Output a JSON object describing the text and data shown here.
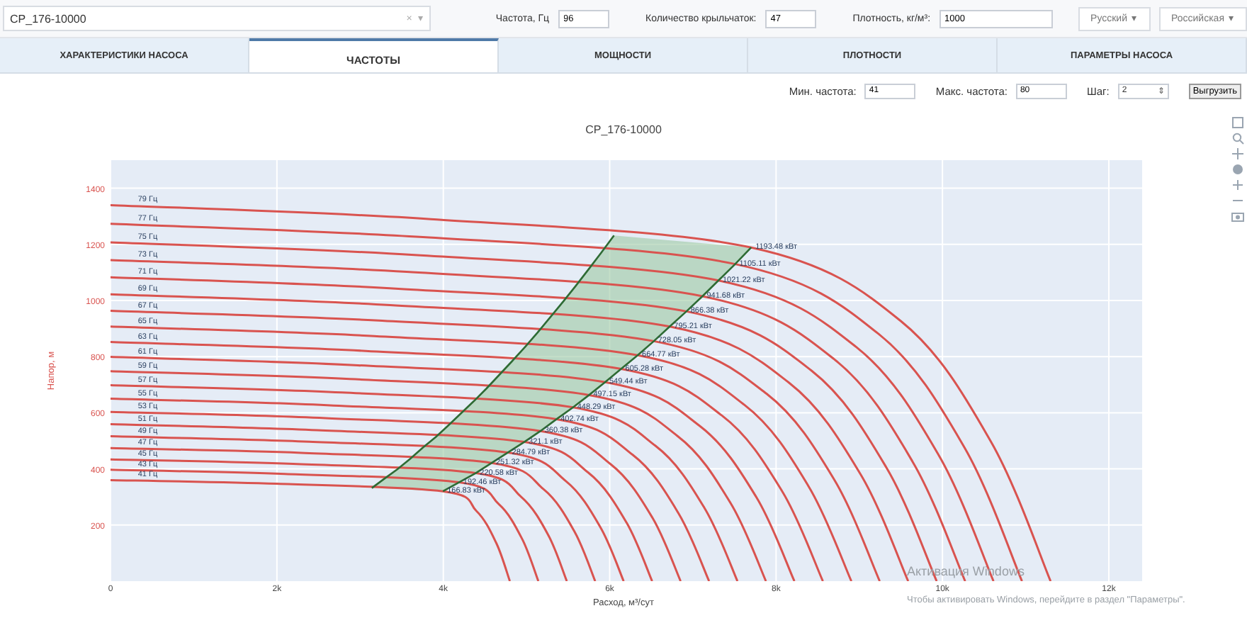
{
  "top_bar": {
    "pump_select": {
      "value": "CP_176-10000",
      "clear": "×",
      "caret": "▾"
    },
    "fields": [
      {
        "label": "Частота, Гц",
        "value": "96",
        "kind": "short"
      },
      {
        "label": "Количество крыльчаток:",
        "value": "47",
        "kind": "short"
      },
      {
        "label": "Плотность, кг/м³:",
        "value": "1000",
        "kind": "long"
      }
    ],
    "dropdowns": [
      {
        "value": "Русский",
        "caret": "▾"
      },
      {
        "value": "Российская",
        "caret": "▾"
      }
    ]
  },
  "tabs": [
    {
      "label": "ХАРАКТЕРИСТИКИ НАСОСА",
      "selected": false
    },
    {
      "label": "ЧАСТОТЫ",
      "selected": true
    },
    {
      "label": "МОЩНОСТИ",
      "selected": false
    },
    {
      "label": "ПЛОТНОСТИ",
      "selected": false
    },
    {
      "label": "ПАРАМЕТРЫ НАСОСА",
      "selected": false
    }
  ],
  "controls": {
    "fields": [
      {
        "label": "Мин. частота:",
        "value": "41"
      },
      {
        "label": "Макс. частота:",
        "value": "80"
      }
    ],
    "step": {
      "label": "Шаг:",
      "value": "2",
      "spinner": "⇕"
    },
    "export_button": "Выгрузить"
  },
  "chart": {
    "chart_data": {
      "type": "line",
      "title": "CP_176-10000",
      "xlabel": "Расход, м³/сут",
      "ylabel": "Напор, м",
      "grid": true,
      "xlim": [
        0,
        12400
      ],
      "ylim": [
        0,
        1500
      ],
      "xticks": [
        {
          "value": 0,
          "label": "0"
        },
        {
          "value": 2000,
          "label": "2k"
        },
        {
          "value": 4000,
          "label": "4k"
        },
        {
          "value": 6000,
          "label": "6k"
        },
        {
          "value": 8000,
          "label": "8k"
        },
        {
          "value": 10000,
          "label": "10k"
        },
        {
          "value": 12000,
          "label": "12k"
        }
      ],
      "yticks": [
        200,
        400,
        600,
        800,
        1000,
        1200,
        1400
      ],
      "series": [
        {
          "name": "79 Гц",
          "color": "#d9534f",
          "x": [
            0,
            3850,
            7700,
            9500,
            10580,
            11300
          ],
          "values": [
            1340,
            1290,
            1189,
            927,
            499,
            0
          ]
        },
        {
          "name": "77 Гц",
          "color": "#d9534f",
          "x": [
            0,
            3754,
            7508,
            9232,
            10266,
            10956
          ],
          "values": [
            1273,
            1226,
            1130,
            881,
            475,
            0
          ]
        },
        {
          "name": "75 Гц",
          "color": "#d9534f",
          "x": [
            0,
            3654,
            7307,
            8961,
            9953,
            10614
          ],
          "values": [
            1207,
            1162,
            1071,
            835,
            450,
            0
          ]
        },
        {
          "name": "73 Гц",
          "color": "#d9534f",
          "x": [
            0,
            3558,
            7115,
            8694,
            9641,
            10272
          ],
          "values": [
            1144,
            1102,
            1015,
            792,
            426,
            0
          ]
        },
        {
          "name": "71 Гц",
          "color": "#d9534f",
          "x": [
            0,
            3461,
            6922,
            8426,
            9328,
            9930
          ],
          "values": [
            1083,
            1042,
            961,
            750,
            404,
            0
          ]
        },
        {
          "name": "69 Гц",
          "color": "#d9534f",
          "x": [
            0,
            3361,
            6722,
            8155,
            9015,
            9588
          ],
          "values": [
            1022,
            984,
            907,
            707,
            381,
            0
          ]
        },
        {
          "name": "67 Гц",
          "color": "#d9534f",
          "x": [
            0,
            3265,
            6530,
            7888,
            8703,
            9246
          ],
          "values": [
            963,
            928,
            855,
            667,
            359,
            0
          ]
        },
        {
          "name": "65 Гц",
          "color": "#d9534f",
          "x": [
            0,
            3169,
            6337,
            7621,
            8391,
            8904
          ],
          "values": [
            907,
            873,
            805,
            628,
            338,
            0
          ]
        },
        {
          "name": "63 Гц",
          "color": "#d9534f",
          "x": [
            0,
            3069,
            6137,
            7350,
            8077,
            8562
          ],
          "values": [
            852,
            820,
            756,
            590,
            318,
            0
          ]
        },
        {
          "name": "61 Гц",
          "color": "#d9534f",
          "x": [
            0,
            2972,
            5944,
            7082,
            7765,
            8220
          ],
          "values": [
            799,
            769,
            709,
            553,
            298,
            0
          ]
        },
        {
          "name": "59 Гц",
          "color": "#d9534f",
          "x": [
            0,
            2876,
            5752,
            6815,
            7453,
            7878
          ],
          "values": [
            748,
            720,
            663,
            517,
            278,
            0
          ]
        },
        {
          "name": "57 Гц",
          "color": "#d9534f",
          "x": [
            0,
            2780,
            5559,
            6548,
            7141,
            7536
          ],
          "values": [
            698,
            672,
            619,
            483,
            260,
            0
          ]
        },
        {
          "name": "55 Гц",
          "color": "#d9534f",
          "x": [
            0,
            2680,
            5359,
            6277,
            6827,
            7194
          ],
          "values": [
            650,
            626,
            577,
            450,
            242,
            0
          ]
        },
        {
          "name": "53 Гц",
          "color": "#d9534f",
          "x": [
            0,
            2584,
            5167,
            6010,
            6515,
            6852
          ],
          "values": [
            603,
            581,
            535,
            417,
            225,
            0
          ]
        },
        {
          "name": "51 Гц",
          "color": "#d9534f",
          "x": [
            0,
            2487,
            4974,
            5742,
            6203,
            6510
          ],
          "values": [
            559,
            538,
            496,
            387,
            208,
            0
          ]
        },
        {
          "name": "49 Гц",
          "color": "#d9534f",
          "x": [
            0,
            2387,
            4774,
            5471,
            5889,
            6168
          ],
          "values": [
            516,
            497,
            458,
            357,
            192,
            0
          ]
        },
        {
          "name": "47 Гц",
          "color": "#d9534f",
          "x": [
            0,
            2291,
            4582,
            5204,
            5577,
            5826
          ],
          "values": [
            474,
            457,
            421,
            328,
            177,
            0
          ]
        },
        {
          "name": "45 Гц",
          "color": "#d9534f",
          "x": [
            0,
            2195,
            4389,
            4937,
            5265,
            5484
          ],
          "values": [
            434,
            418,
            385,
            300,
            162,
            0
          ]
        },
        {
          "name": "43 Гц",
          "color": "#d9534f",
          "x": [
            0,
            2095,
            4189,
            4666,
            4951,
            5142
          ],
          "values": [
            397,
            382,
            352,
            275,
            148,
            0
          ]
        },
        {
          "name": "41 Гц",
          "color": "#d9534f",
          "x": [
            0,
            1998,
            3996,
            4398,
            4639,
            4800
          ],
          "values": [
            360,
            347,
            320,
            250,
            134,
            0
          ]
        },
        {
          "color": "#2e6b34",
          "x": [
            3141,
            3293,
            3450,
            3601,
            3752,
            3910,
            4061,
            4212,
            4369,
            4521,
            4672,
            4824,
            4981,
            5133,
            5283,
            5441,
            5592,
            5743,
            5901,
            6052
          ],
          "values": [
            332,
            365,
            399,
            436,
            475,
            514,
            555,
            598,
            642,
            687,
            735,
            783,
            834,
            886,
            940,
            996,
            1052,
            1110,
            1171,
            1232
          ]
        },
        {
          "color": "#2e6b34",
          "x": [
            3996,
            4189,
            4389,
            4582,
            4774,
            4974,
            5167,
            5359,
            5559,
            5752,
            5944,
            6137,
            6337,
            6530,
            6722,
            6922,
            7115,
            7307,
            7508,
            7700
          ],
          "values": [
            320,
            352,
            385,
            421,
            458,
            496,
            535,
            577,
            619,
            663,
            709,
            756,
            805,
            855,
            907,
            961,
            1015,
            1071,
            1130,
            1189
          ]
        }
      ],
      "annotations": [
        {
          "text": "1193.48 кВт",
          "x": 7700,
          "y": 1189
        },
        {
          "text": "1105.11 кВт",
          "x": 7508,
          "y": 1130
        },
        {
          "text": "1021.22 кВт",
          "x": 7307,
          "y": 1071
        },
        {
          "text": "941.68 кВт",
          "x": 7115,
          "y": 1015
        },
        {
          "text": "866.38 кВт",
          "x": 6922,
          "y": 961
        },
        {
          "text": "795.21 кВт",
          "x": 6722,
          "y": 907
        },
        {
          "text": "728.05 кВт",
          "x": 6530,
          "y": 855
        },
        {
          "text": "664.77 кВт",
          "x": 6337,
          "y": 805
        },
        {
          "text": "605.28 кВт",
          "x": 6137,
          "y": 756
        },
        {
          "text": "549.44 кВт",
          "x": 5944,
          "y": 709
        },
        {
          "text": "497.15 кВт",
          "x": 5752,
          "y": 663
        },
        {
          "text": "448.29 кВт",
          "x": 5559,
          "y": 619
        },
        {
          "text": "402.74 кВт",
          "x": 5359,
          "y": 577
        },
        {
          "text": "360.38 кВт",
          "x": 5167,
          "y": 535
        },
        {
          "text": "321.1 кВт",
          "x": 4974,
          "y": 496
        },
        {
          "text": "284.79 кВт",
          "x": 4774,
          "y": 458
        },
        {
          "text": "251.32 кВт",
          "x": 4582,
          "y": 421
        },
        {
          "text": "220.58 кВт",
          "x": 4389,
          "y": 385
        },
        {
          "text": "192.46 кВт",
          "x": 4189,
          "y": 352
        },
        {
          "text": "166.83 кВт",
          "x": 3996,
          "y": 320
        }
      ]
    }
  },
  "os_notice": {
    "title": "Активация Windows",
    "text": "Чтобы активировать Windows, перейдите в раздел \"Параметры\"."
  }
}
